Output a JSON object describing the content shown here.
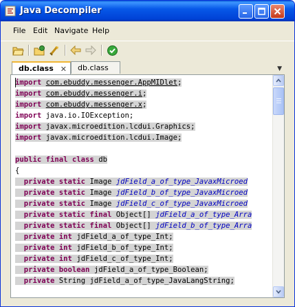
{
  "window": {
    "title": "Java Decompiler"
  },
  "menu": {
    "items": [
      "File",
      "Edit",
      "Navigate",
      "Help"
    ]
  },
  "toolbar": {
    "icons": [
      "open-file-icon",
      "open-type-icon",
      "open-type-hierarchy-icon",
      "back-icon",
      "forward-icon",
      "search-globe-icon"
    ]
  },
  "tabs": [
    {
      "label": "db.class",
      "active": true,
      "closable": true
    },
    {
      "label": "db.class",
      "active": false,
      "closable": false
    }
  ],
  "tab_close_glyph": "✕",
  "tab_menu_glyph": "▼",
  "code_lines": [
    {
      "hl": true,
      "parts": [
        {
          "t": "import",
          "c": "kw"
        },
        {
          "t": " "
        },
        {
          "t": "com.ebuddy.messenger.AppMIDlet",
          "c": "lnk"
        },
        {
          "t": ";"
        }
      ]
    },
    {
      "hl": true,
      "parts": [
        {
          "t": "import",
          "c": "kw"
        },
        {
          "t": " "
        },
        {
          "t": "com.ebuddy.messenger.i",
          "c": "lnk"
        },
        {
          "t": ";"
        }
      ]
    },
    {
      "hl": true,
      "parts": [
        {
          "t": "import",
          "c": "kw"
        },
        {
          "t": " "
        },
        {
          "t": "com.ebuddy.messenger.x",
          "c": "lnk"
        },
        {
          "t": ";"
        }
      ]
    },
    {
      "hl": false,
      "parts": [
        {
          "t": "import",
          "c": "kw"
        },
        {
          "t": " java.io.IOException;"
        }
      ]
    },
    {
      "hl": true,
      "parts": [
        {
          "t": "import",
          "c": "kw"
        },
        {
          "t": " javax.microedition.lcdui.Graphics;"
        }
      ]
    },
    {
      "hl": true,
      "parts": [
        {
          "t": "import",
          "c": "kw"
        },
        {
          "t": " javax.microedition.lcdui.Image;"
        }
      ]
    },
    {
      "hl": false,
      "parts": [
        {
          "t": ""
        }
      ]
    },
    {
      "hl": true,
      "parts": [
        {
          "t": "public final class",
          "c": "kw"
        },
        {
          "t": " db"
        }
      ]
    },
    {
      "hl": false,
      "parts": [
        {
          "t": "{"
        }
      ]
    },
    {
      "hl": true,
      "parts": [
        {
          "t": "  "
        },
        {
          "t": "private static",
          "c": "kw"
        },
        {
          "t": " Image "
        },
        {
          "t": "jdField_a_of_type_JavaxMicroed",
          "c": "ty"
        }
      ]
    },
    {
      "hl": true,
      "parts": [
        {
          "t": "  "
        },
        {
          "t": "private static",
          "c": "kw"
        },
        {
          "t": " Image "
        },
        {
          "t": "jdField_b_of_type_JavaxMicroed",
          "c": "ty"
        }
      ]
    },
    {
      "hl": true,
      "parts": [
        {
          "t": "  "
        },
        {
          "t": "private static",
          "c": "kw"
        },
        {
          "t": " Image "
        },
        {
          "t": "jdField_c_of_type_JavaxMicroed",
          "c": "ty"
        }
      ]
    },
    {
      "hl": true,
      "parts": [
        {
          "t": "  "
        },
        {
          "t": "private static final",
          "c": "kw"
        },
        {
          "t": " Object[] "
        },
        {
          "t": "jdField_a_of_type_Arra",
          "c": "ty"
        }
      ]
    },
    {
      "hl": true,
      "parts": [
        {
          "t": "  "
        },
        {
          "t": "private static final",
          "c": "kw"
        },
        {
          "t": " Object[] "
        },
        {
          "t": "jdField_b_of_type_Arra",
          "c": "ty"
        }
      ]
    },
    {
      "hl": true,
      "parts": [
        {
          "t": "  "
        },
        {
          "t": "private int",
          "c": "kw"
        },
        {
          "t": " jdField_a_of_type_Int;"
        }
      ]
    },
    {
      "hl": true,
      "parts": [
        {
          "t": "  "
        },
        {
          "t": "private int",
          "c": "kw"
        },
        {
          "t": " jdField_b_of_type_Int;"
        }
      ]
    },
    {
      "hl": true,
      "parts": [
        {
          "t": "  "
        },
        {
          "t": "private int",
          "c": "kw"
        },
        {
          "t": " jdField_c_of_type_Int;"
        }
      ]
    },
    {
      "hl": true,
      "parts": [
        {
          "t": "  "
        },
        {
          "t": "private boolean",
          "c": "kw"
        },
        {
          "t": " jdField_a_of_type_Boolean;"
        }
      ]
    },
    {
      "hl": true,
      "parts": [
        {
          "t": "  "
        },
        {
          "t": "private",
          "c": "kw"
        },
        {
          "t": " String jdField_a_of_type_JavaLangString;"
        }
      ]
    }
  ],
  "colors": {
    "keyword": "#7f0055",
    "type_field": "#0000c0",
    "highlight": "#d4d4d4",
    "title_bar": "#0758e8"
  }
}
